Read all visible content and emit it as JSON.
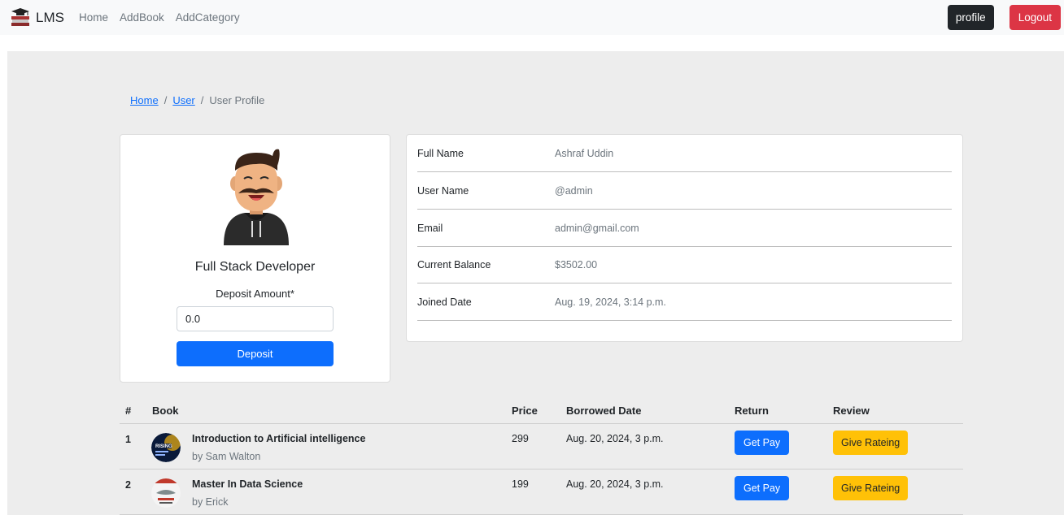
{
  "navbar": {
    "brand": "LMS",
    "links": [
      "Home",
      "AddBook",
      "AddCategory"
    ],
    "profile_label": "profile",
    "logout_label": "Logout"
  },
  "breadcrumb": {
    "items": [
      "Home",
      "User"
    ],
    "active": "User Profile"
  },
  "profile_card": {
    "title": "Full Stack Developer",
    "deposit_label": "Deposit Amount*",
    "deposit_value": "0.0",
    "deposit_button": "Deposit"
  },
  "user_info": [
    {
      "label": "Full Name",
      "value": "Ashraf Uddin"
    },
    {
      "label": "User Name",
      "value": "@admin"
    },
    {
      "label": "Email",
      "value": "admin@gmail.com"
    },
    {
      "label": "Current Balance",
      "value": "$3502.00"
    },
    {
      "label": "Joined Date",
      "value": "Aug. 19, 2024, 3:14 p.m."
    }
  ],
  "table": {
    "headers": {
      "num": "#",
      "book": "Book",
      "price": "Price",
      "borrowed": "Borrowed Date",
      "return": "Return",
      "review": "Review"
    },
    "rows": [
      {
        "num": "1",
        "title": "Introduction to Artificial intelligence",
        "author": "by Sam Walton",
        "price": "299",
        "date": "Aug. 20, 2024, 3 p.m.",
        "pay_label": "Get Pay",
        "rate_label": "Give Rateing"
      },
      {
        "num": "2",
        "title": "Master In Data Science",
        "author": "by Erick",
        "price": "199",
        "date": "Aug. 20, 2024, 3 p.m.",
        "pay_label": "Get Pay",
        "rate_label": "Give Rateing"
      }
    ]
  },
  "colors": {
    "primary": "#0d6efd",
    "danger": "#dc3545",
    "warning": "#ffc107",
    "dark": "#212529"
  }
}
